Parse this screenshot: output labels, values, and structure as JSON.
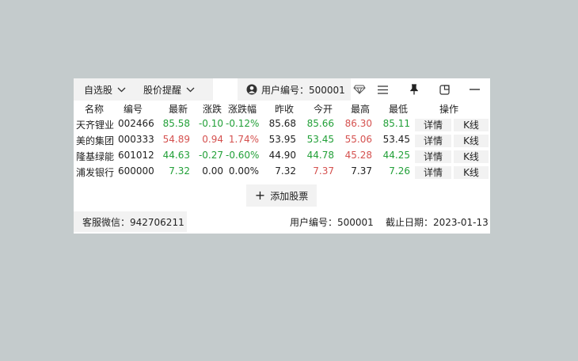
{
  "toolbar": {
    "watchlist_label": "自选股",
    "alert_label": "股价提醒",
    "user_label": "用户编号：500001"
  },
  "icons": [
    "user-icon",
    "gem-icon",
    "menu-icon",
    "pin-icon",
    "popout-icon",
    "minimize-icon"
  ],
  "colors": {
    "up": "#d5514f",
    "down": "#22a038",
    "background": "#c4cbcc"
  },
  "table": {
    "headers": [
      "名称",
      "编号",
      "最新",
      "涨跌",
      "涨跌幅",
      "昨收",
      "今开",
      "最高",
      "最低",
      "操作"
    ],
    "rows": [
      {
        "name": "天齐锂业",
        "code": "002466",
        "latest": "85.58",
        "change": "-0.10",
        "pct": "-0.12%",
        "prev": "85.68",
        "open": "85.66",
        "high": "86.30",
        "low": "85.11",
        "detail": "详情",
        "kline": "K线",
        "c_latest": "green",
        "c_change": "green",
        "c_pct": "green",
        "c_open": "green",
        "c_high": "red",
        "c_low": "green"
      },
      {
        "name": "美的集团",
        "code": "000333",
        "latest": "54.89",
        "change": "0.94",
        "pct": "1.74%",
        "prev": "53.95",
        "open": "53.45",
        "high": "55.06",
        "low": "53.45",
        "detail": "详情",
        "kline": "K线",
        "c_latest": "red",
        "c_change": "red",
        "c_pct": "red",
        "c_open": "green",
        "c_high": "red",
        "c_low": ""
      },
      {
        "name": "隆基绿能",
        "code": "601012",
        "latest": "44.63",
        "change": "-0.27",
        "pct": "-0.60%",
        "prev": "44.90",
        "open": "44.78",
        "high": "45.28",
        "low": "44.25",
        "detail": "详情",
        "kline": "K线",
        "c_latest": "green",
        "c_change": "green",
        "c_pct": "green",
        "c_open": "green",
        "c_high": "red",
        "c_low": "green"
      },
      {
        "name": "浦发银行",
        "code": "600000",
        "latest": "7.32",
        "change": "0.00",
        "pct": "0.00%",
        "prev": "7.32",
        "open": "7.37",
        "high": "7.37",
        "low": "7.26",
        "detail": "详情",
        "kline": "K线",
        "c_latest": "green",
        "c_change": "",
        "c_pct": "",
        "c_open": "red",
        "c_high": "",
        "c_low": "green"
      }
    ]
  },
  "add_stock_label": "添加股票",
  "footer": {
    "support": "客服微信：942706211",
    "user": "用户编号：500001",
    "expiry": "截止日期：2023-01-13"
  }
}
